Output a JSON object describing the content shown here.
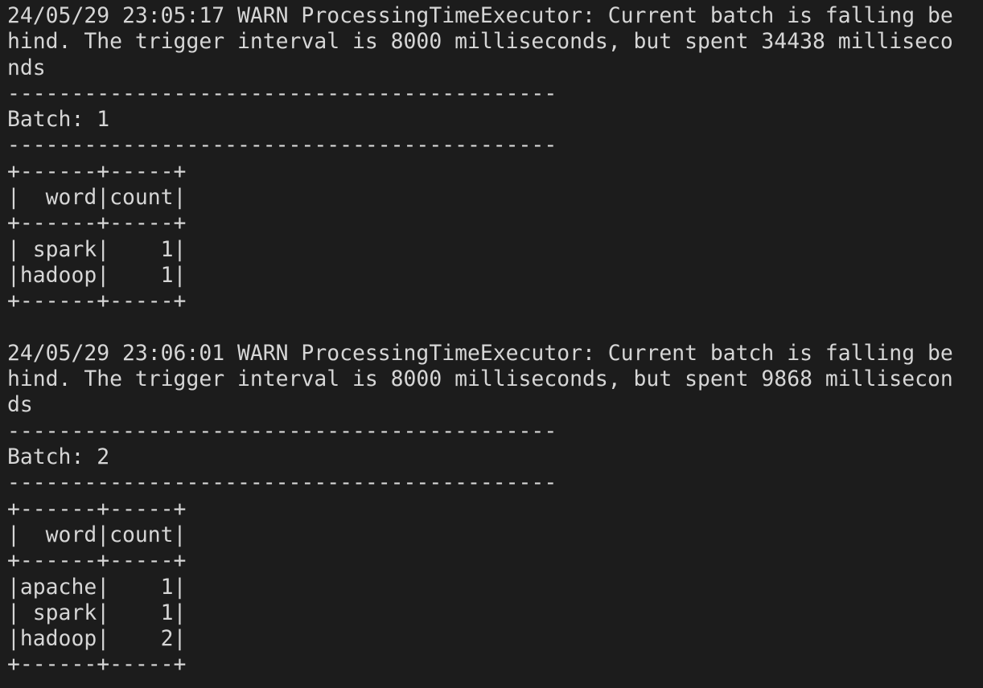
{
  "terminal": {
    "lines": [
      "24/05/29 23:05:17 WARN ProcessingTimeExecutor: Current batch is falling be",
      "hind. The trigger interval is 8000 milliseconds, but spent 34438 milliseco",
      "nds",
      "-------------------------------------------",
      "Batch: 1",
      "-------------------------------------------",
      "+------+-----+",
      "|  word|count|",
      "+------+-----+",
      "| spark|    1|",
      "|hadoop|    1|",
      "+------+-----+",
      "",
      "24/05/29 23:06:01 WARN ProcessingTimeExecutor: Current batch is falling be",
      "hind. The trigger interval is 8000 milliseconds, but spent 9868 millisecon",
      "ds",
      "-------------------------------------------",
      "Batch: 2",
      "-------------------------------------------",
      "+------+-----+",
      "|  word|count|",
      "+------+-----+",
      "|apache|    1|",
      "| spark|    1|",
      "|hadoop|    2|",
      "+------+-----+"
    ]
  },
  "colors": {
    "background": "#1c1c1c",
    "foreground": "#d6d6d6"
  }
}
